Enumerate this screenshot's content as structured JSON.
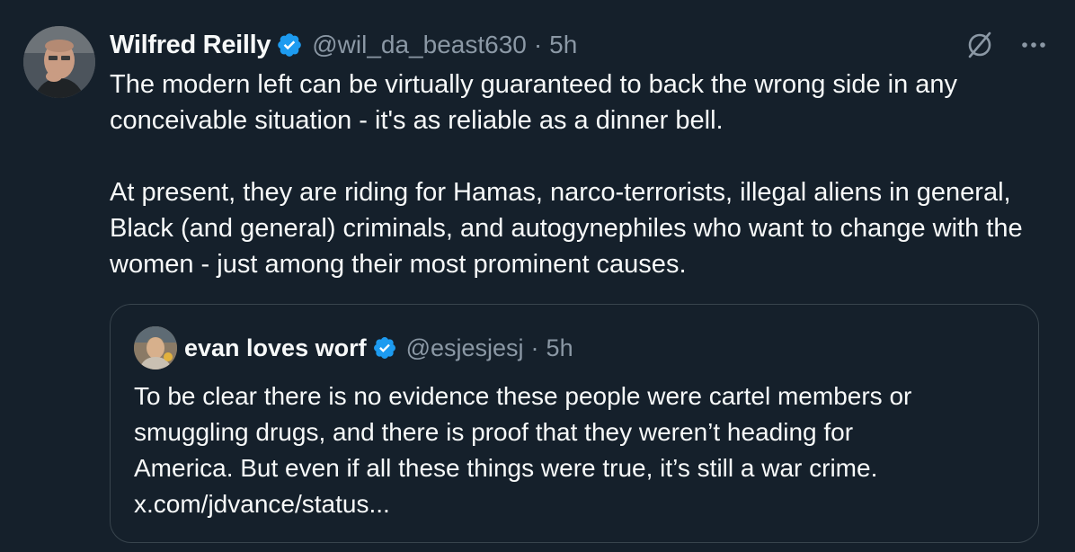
{
  "tweet": {
    "author": {
      "display_name": "Wilfred Reilly",
      "handle": "@wil_da_beast630",
      "time": "5h",
      "verified_icon": "verified-badge-icon"
    },
    "separator": "·",
    "body": [
      "The modern left can be virtually guaranteed to back the wrong side in any conceivable situation - it's as reliable as a dinner bell.",
      "At present, they are riding for Hamas, narco-terrorists, illegal aliens in general, Black (and general) criminals, and autogynephiles who want to change with the women - just among their most prominent causes."
    ],
    "actions": {
      "grok_icon": "grok-icon",
      "more_icon": "more-icon",
      "more_label": "···"
    }
  },
  "quote": {
    "author": {
      "display_name": "evan loves worf",
      "handle": "@esjesjesj",
      "time": "5h"
    },
    "separator": "·",
    "text_lines": [
      "To be clear there is no evidence these people were cartel members or",
      "smuggling drugs, and there is proof that they weren’t heading for",
      "America. But even if all these things were true, it’s still a war crime.",
      "x.com/jdvance/status..."
    ]
  },
  "colors": {
    "background": "#15202b",
    "text_primary": "#f7f9f9",
    "text_secondary": "#8b98a5",
    "verified_blue": "#1d9bf0",
    "border": "#38444d"
  }
}
